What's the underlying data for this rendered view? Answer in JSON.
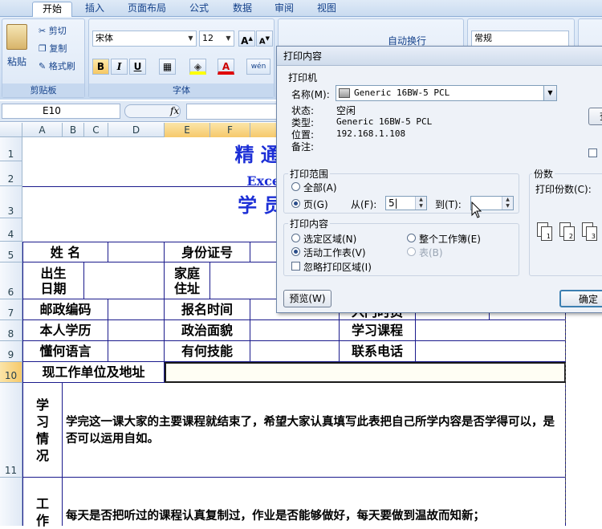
{
  "ribbon": {
    "tabs": [
      "开始",
      "插入",
      "页面布局",
      "公式",
      "数据",
      "审阅",
      "视图"
    ],
    "clipboard": {
      "paste": "粘贴",
      "cut": "剪切",
      "copy": "复制",
      "format_painter": "格式刷",
      "group": "剪贴板"
    },
    "font": {
      "name": "宋体",
      "size": "12",
      "bold": "B",
      "italic": "I",
      "underline": "U",
      "font_color": "A",
      "group": "字体",
      "wen": "wén"
    },
    "alignment": {
      "wrap_text": "自动换行"
    },
    "number": {
      "format": "常规"
    }
  },
  "formula_bar": {
    "name_box": "E10",
    "fx": "fx"
  },
  "columns": [
    "A",
    "B",
    "C",
    "D",
    "E",
    "F"
  ],
  "rows": [
    "1",
    "2",
    "3",
    "4",
    "5",
    "6",
    "7",
    "8",
    "9",
    "10",
    "11"
  ],
  "sheet": {
    "title1": "精 通 电 脑",
    "title2": "Excel 学习班",
    "title3": "学 员 入",
    "name_label": "姓  名",
    "id_label": "身份证号",
    "birth_label": "出生\n日期",
    "home_label": "家庭\n住址",
    "zip_label": "邮政编码",
    "signup_label": "报名时间",
    "enroll_label": "入门时员",
    "edu_label": "本人学历",
    "politics_label": "政治面貌",
    "course_label": "学习课程",
    "lang_label": "懂何语言",
    "skill_label": "有何技能",
    "phone_label": "联系电话",
    "work_label": "现工作单位及地址",
    "study_label": "学\n习\n情\n况",
    "study_text": "学完这一课大家的主要课程就结束了，希望大家认真填写此表把自己所学内容是否学得可以，是否可以运用自如。",
    "work2_label": "工\n作",
    "work2_text": "每天是否把听过的课程认真复制过，作业是否能够做好，每天要做到温故而知新；"
  },
  "dialog": {
    "title": "打印内容",
    "printer_section": "打印机",
    "name_label": "名称(M):",
    "printer_name": "Generic 16BW-5 PCL",
    "status_label": "状态:",
    "status_value": "空闲",
    "type_label": "类型:",
    "type_value": "Generic 16BW-5 PCL",
    "location_label": "位置:",
    "location_value": "192.168.1.108",
    "comment_label": "备注:",
    "range_section": "打印范围",
    "all_label": "全部(A)",
    "pages_label": "页(G)",
    "from_label": "从(F):",
    "from_value": "5",
    "to_label": "到(T):",
    "to_value": "",
    "what_section": "打印内容",
    "selection_label": "选定区域(N)",
    "workbook_label": "整个工作簿(E)",
    "active_label": "活动工作表(V)",
    "table_label": "表(B)",
    "ignore_label": "忽略打印区域(I)",
    "copies_section": "份数",
    "copies_label": "打印份数(C):",
    "preview_button": "预览(W)",
    "ok_button": "确定",
    "find_button": "查"
  }
}
